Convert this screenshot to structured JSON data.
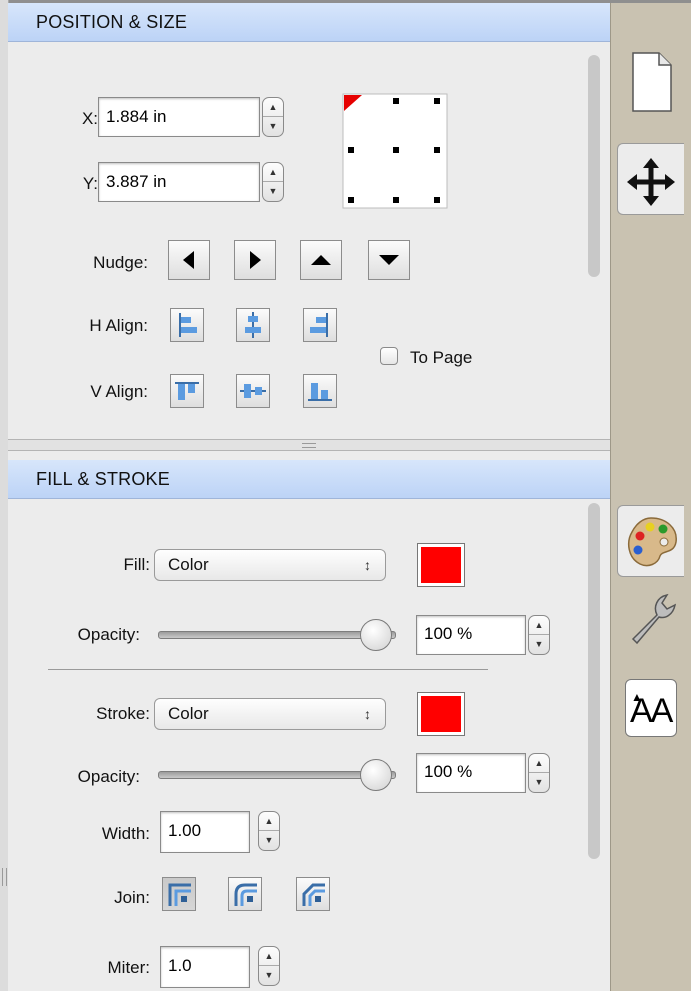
{
  "position_size": {
    "header": "POSITION & SIZE",
    "x_label": "X:",
    "x_value": "1.884 in",
    "y_label": "Y:",
    "y_value": "3.887 in",
    "nudge_label": "Nudge:",
    "h_align_label": "H Align:",
    "v_align_label": "V Align:",
    "to_page_label": "To Page",
    "to_page_checked": false
  },
  "fill_stroke": {
    "header": "FILL & STROKE",
    "fill_label": "Fill:",
    "fill_type": "Color",
    "fill_color": "#ff0000",
    "fill_opacity_label": "Opacity:",
    "fill_opacity_value": "100 %",
    "fill_opacity_level": 1.0,
    "stroke_label": "Stroke:",
    "stroke_type": "Color",
    "stroke_color": "#ff0000",
    "stroke_opacity_label": "Opacity:",
    "stroke_opacity_value": "100 %",
    "stroke_opacity_level": 1.0,
    "width_label": "Width:",
    "width_value": "1.00",
    "join_label": "Join:",
    "miter_label": "Miter:",
    "miter_value": "1.0"
  },
  "tabs": {
    "items": [
      "document-icon",
      "move-arrows-icon",
      "palette-icon",
      "wrench-icon",
      "font-size-icon"
    ],
    "active": [
      "move-arrows-icon",
      "palette-icon"
    ],
    "font_tab_glyph": "AA"
  },
  "colors": {
    "header_blue": "#c6dbf8",
    "panel_bg": "#ececec",
    "tab_bg": "#c9c2b1"
  }
}
